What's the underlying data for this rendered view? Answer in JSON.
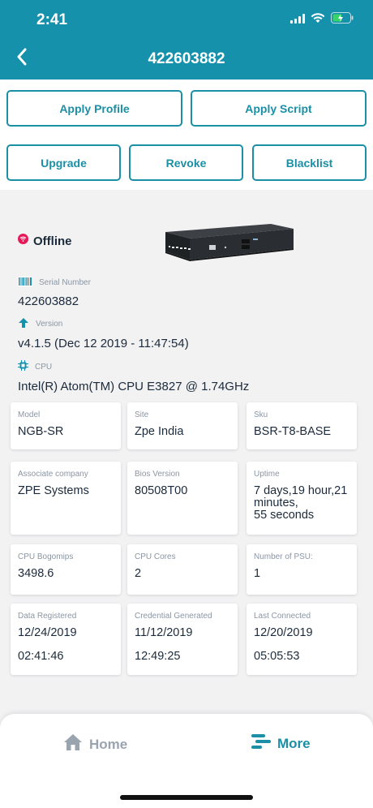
{
  "status_bar": {
    "time": "2:41"
  },
  "header": {
    "title": "422603882"
  },
  "actions": {
    "apply_profile": "Apply Profile",
    "apply_script": "Apply Script",
    "upgrade": "Upgrade",
    "revoke": "Revoke",
    "blacklist": "Blacklist"
  },
  "device": {
    "status": "Offline",
    "serial_label": "Serial Number",
    "serial_value": "422603882",
    "version_label": "Version",
    "version_value": "v4.1.5 (Dec 12 2019 - 11:47:54)",
    "cpu_label": "CPU",
    "cpu_value": "Intel(R) Atom(TM) CPU  E3827  @ 1.74GHz"
  },
  "tiles": {
    "model": {
      "label": "Model",
      "value": "NGB-SR"
    },
    "site": {
      "label": "Site",
      "value": "Zpe India"
    },
    "sku": {
      "label": "Sku",
      "value": "BSR-T8-BASE"
    },
    "associate_company": {
      "label": "Associate company",
      "value": "ZPE Systems"
    },
    "bios_version": {
      "label": "Bios Version",
      "value": "80508T00"
    },
    "uptime": {
      "label": "Uptime",
      "line1": "7 days,19 hour,21",
      "line2": "minutes,",
      "line3": "55 seconds"
    },
    "cpu_bogomips": {
      "label": "CPU Bogomips",
      "value": "3498.6"
    },
    "cpu_cores": {
      "label": "CPU Cores",
      "value": "2"
    },
    "num_psu": {
      "label": "Number of PSU:",
      "value": "1"
    },
    "data_registered": {
      "label": "Data Registered",
      "date": "12/24/2019",
      "time": "02:41:46"
    },
    "credential_generated": {
      "label": "Credential Generated",
      "date": "11/12/2019",
      "time": "12:49:25"
    },
    "last_connected": {
      "label": "Last Connected",
      "date": "12/20/2019",
      "time": "05:05:53"
    }
  },
  "nav": {
    "home": "Home",
    "more": "More"
  },
  "colors": {
    "brand": "#1591ab",
    "accent": "#1a8fa6",
    "offline": "#e5195a",
    "inactive": "#9aa4ae"
  },
  "icons": {
    "status": "wifi-offline-icon",
    "serial": "barcode-icon",
    "version": "upload-arrow-icon",
    "cpu": "chip-icon",
    "home": "home-icon",
    "more": "menu-lines-icon"
  }
}
